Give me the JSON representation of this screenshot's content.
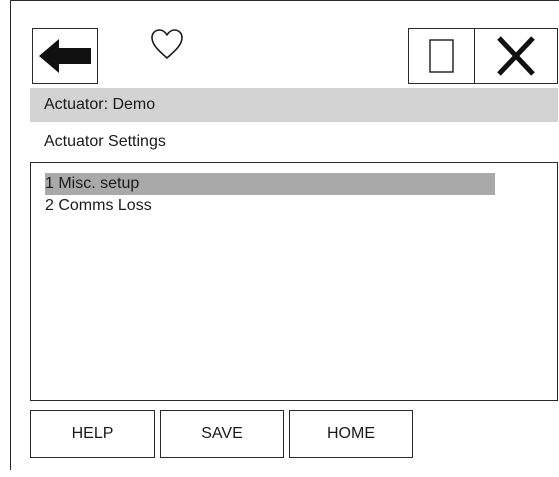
{
  "header": {
    "back_icon": "arrow-left-icon",
    "favorite_icon": "heart-outline-icon",
    "window_icon": "rectangle-icon",
    "close_icon": "close-x-icon"
  },
  "titlebar": {
    "text": "Actuator: Demo"
  },
  "subtitle": {
    "text": "Actuator Settings"
  },
  "list": {
    "items": [
      {
        "label": "1 Misc. setup",
        "selected": true
      },
      {
        "label": "2 Comms Loss",
        "selected": false
      }
    ]
  },
  "footer": {
    "help_label": "HELP",
    "save_label": "SAVE",
    "home_label": "HOME"
  },
  "colors": {
    "titlebar_bg": "#d3d3d3",
    "selection_bg": "#a9a9a9",
    "outline": "#2a2a2a"
  }
}
